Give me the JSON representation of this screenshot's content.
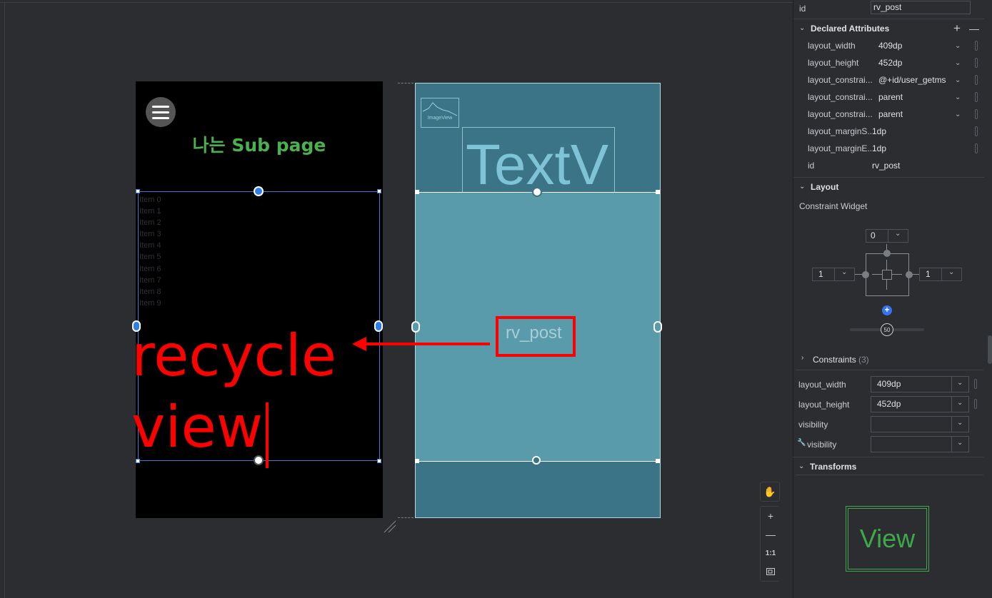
{
  "design": {
    "title": "나는 Sub page",
    "recycler_items": [
      "Item 0",
      "Item 1",
      "Item 2",
      "Item 3",
      "Item 4",
      "Item 5",
      "Item 6",
      "Item 7",
      "Item 8",
      "Item 9"
    ],
    "annotation_line1": "recycle",
    "annotation_line2": "view"
  },
  "blueprint": {
    "imageview_label": "ImageView",
    "textview_label": "TextV",
    "rv_label": "rv_post"
  },
  "zoom": {
    "one_to_one": "1:1"
  },
  "attributes": {
    "id_key": "id",
    "id_value": "rv_post",
    "declared_title": "Declared Attributes",
    "declared": [
      {
        "key": "layout_width",
        "value": "409dp",
        "dropdown": true
      },
      {
        "key": "layout_height",
        "value": "452dp",
        "dropdown": true
      },
      {
        "key": "layout_constrai...",
        "value": "@+id/user_getms",
        "dropdown": true
      },
      {
        "key": "layout_constrai...",
        "value": "parent",
        "dropdown": true
      },
      {
        "key": "layout_constrai...",
        "value": "parent",
        "dropdown": true
      },
      {
        "key": "layout_marginS...",
        "value": "1dp",
        "dropdown": false
      },
      {
        "key": "layout_marginE...",
        "value": "1dp",
        "dropdown": false
      },
      {
        "key": "id",
        "value": "rv_post",
        "dropdown": false
      }
    ],
    "layout_title": "Layout",
    "constraint_widget_label": "Constraint Widget",
    "margin_top": "0",
    "margin_left": "1",
    "margin_right": "1",
    "bias": "50",
    "constraints_label": "Constraints",
    "constraints_count": "(3)",
    "layout_fields": [
      {
        "key": "layout_width",
        "value": "409dp"
      },
      {
        "key": "layout_height",
        "value": "452dp"
      },
      {
        "key": "visibility",
        "value": ""
      },
      {
        "key": "visibility",
        "value": ""
      }
    ],
    "transforms_title": "Transforms",
    "preview_label": "View"
  }
}
